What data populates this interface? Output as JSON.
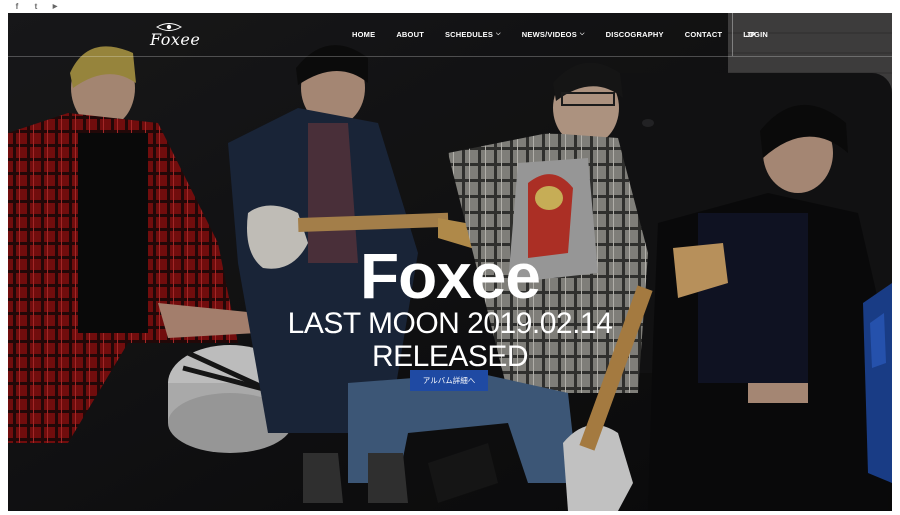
{
  "social": {
    "items": [
      {
        "icon": "facebook-icon",
        "glyph": "f"
      },
      {
        "icon": "twitter-icon",
        "glyph": "t"
      },
      {
        "icon": "youtube-icon",
        "glyph": "▶"
      }
    ]
  },
  "header": {
    "logo_text": "Foxee",
    "menu": [
      {
        "label": "HOME",
        "has_dropdown": false
      },
      {
        "label": "ABOUT",
        "has_dropdown": false
      },
      {
        "label": "SCHEDULES",
        "has_dropdown": true
      },
      {
        "label": "NEWS/VIDEOS",
        "has_dropdown": true
      },
      {
        "label": "DISCOGRAPHY",
        "has_dropdown": false
      },
      {
        "label": "CONTACT",
        "has_dropdown": false
      },
      {
        "label": "LOGIN",
        "has_dropdown": false
      }
    ],
    "language": "JP",
    "dropdown_glyph": "⌵"
  },
  "hero": {
    "title": "Foxee",
    "line1": "LAST MOON 2019.02.14",
    "line2": "RELEASED",
    "cta_label": "アルバム詳細へ"
  },
  "colors": {
    "cta_bg": "#1f4aa3",
    "nav_text": "#ffffff"
  }
}
